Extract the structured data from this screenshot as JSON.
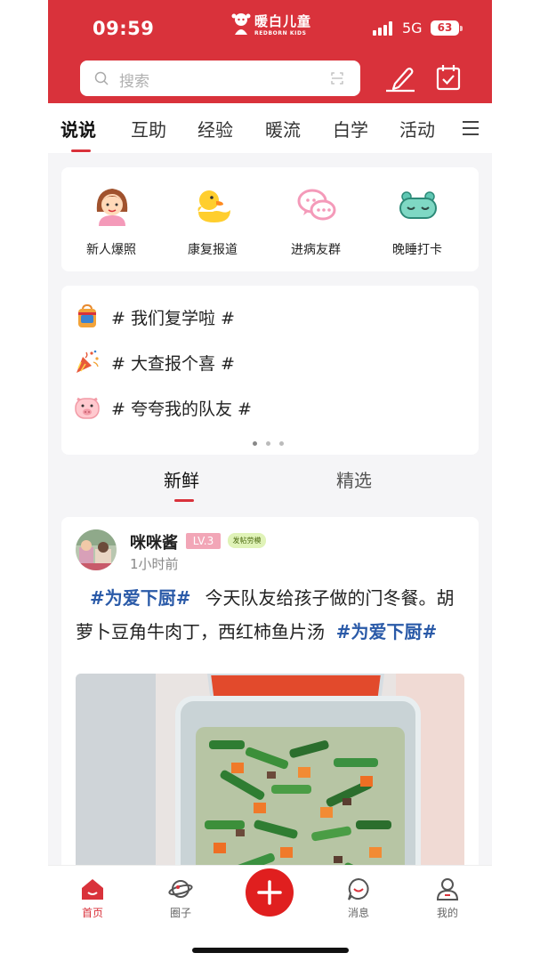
{
  "status_bar": {
    "time": "09:59",
    "network": "5G",
    "battery": "63"
  },
  "brand": {
    "name": "暖白儿童",
    "sub": "REDBORN KIDS"
  },
  "search": {
    "placeholder": "搜索"
  },
  "tabs": [
    "说说",
    "互助",
    "经验",
    "暖流",
    "白学",
    "活动"
  ],
  "active_tab": "说说",
  "quick_entries": [
    {
      "label": "新人爆照",
      "icon": "girl-avatar-icon"
    },
    {
      "label": "康复报道",
      "icon": "duck-icon"
    },
    {
      "label": "进病友群",
      "icon": "chat-group-icon"
    },
    {
      "label": "晚睡打卡",
      "icon": "sleep-mask-icon"
    }
  ],
  "topics": [
    {
      "text": "# 我们复学啦 #",
      "icon": "school-bag-icon"
    },
    {
      "text": "# 大查报个喜 #",
      "icon": "party-popper-icon"
    },
    {
      "text": "# 夸夸我的队友 #",
      "icon": "pig-icon"
    }
  ],
  "sub_tabs": [
    "新鲜",
    "精选"
  ],
  "active_sub_tab": "新鲜",
  "post": {
    "username": "咪咪酱",
    "level": "LV.3",
    "badge": "发帖劳模",
    "time": "1小时前",
    "hashtag": "#为爱下厨#",
    "text": "今天队友给孩子做的门冬餐。胡萝卜豆角牛肉丁，西红柿鱼片汤",
    "hashtag_end": "#为爱下厨#"
  },
  "bottom_nav": [
    {
      "label": "首页",
      "icon": "home-icon"
    },
    {
      "label": "圈子",
      "icon": "planet-icon"
    },
    {
      "label": "消息",
      "icon": "message-icon"
    },
    {
      "label": "我的",
      "icon": "profile-icon"
    }
  ],
  "colors": {
    "brand_red": "#d9323b",
    "hashtag_blue": "#2a5aa8",
    "fab_red": "#e01f1f"
  }
}
